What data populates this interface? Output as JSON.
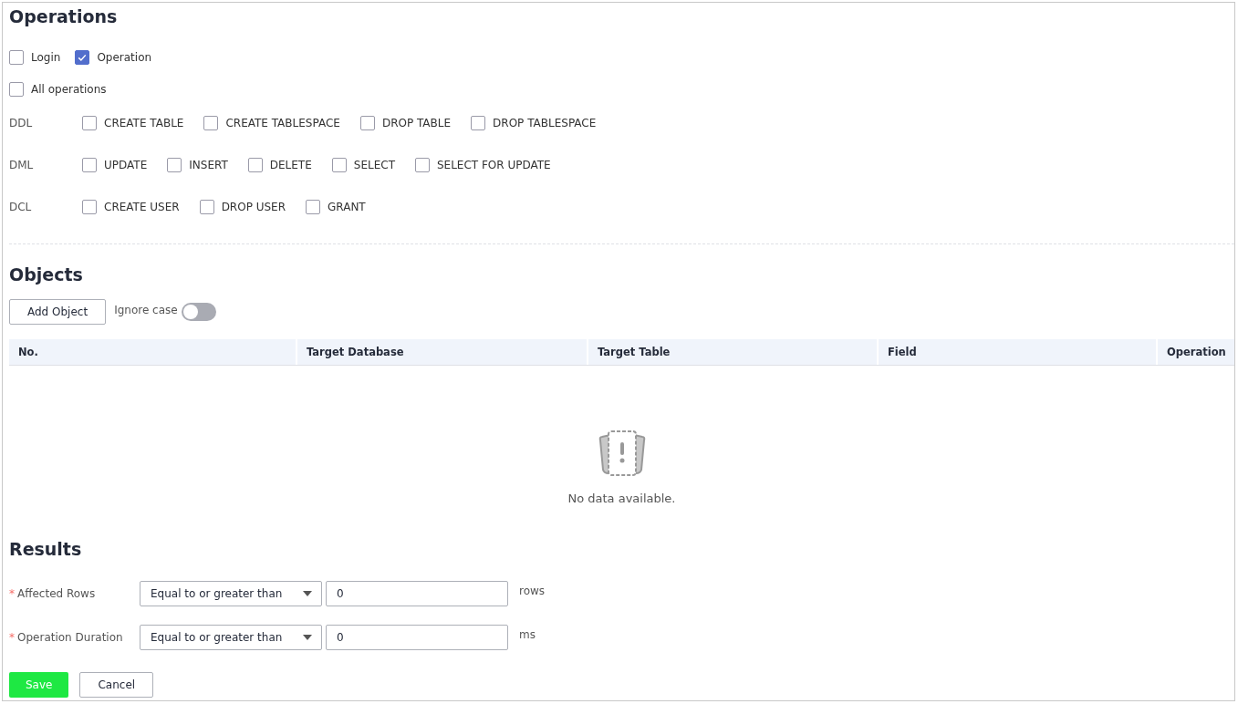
{
  "operations": {
    "title": "Operations",
    "types": [
      {
        "label": "Login",
        "checked": false
      },
      {
        "label": "Operation",
        "checked": true
      }
    ],
    "all": {
      "label": "All operations",
      "checked": false
    },
    "groups": [
      {
        "name": "DDL",
        "items": [
          {
            "label": "CREATE TABLE",
            "checked": false
          },
          {
            "label": "CREATE TABLESPACE",
            "checked": false
          },
          {
            "label": "DROP TABLE",
            "checked": false
          },
          {
            "label": "DROP TABLESPACE",
            "checked": false
          }
        ]
      },
      {
        "name": "DML",
        "items": [
          {
            "label": "UPDATE",
            "checked": false
          },
          {
            "label": "INSERT",
            "checked": false
          },
          {
            "label": "DELETE",
            "checked": false
          },
          {
            "label": "SELECT",
            "checked": false
          },
          {
            "label": "SELECT FOR UPDATE",
            "checked": false
          }
        ]
      },
      {
        "name": "DCL",
        "items": [
          {
            "label": "CREATE USER",
            "checked": false
          },
          {
            "label": "DROP USER",
            "checked": false
          },
          {
            "label": "GRANT",
            "checked": false
          }
        ]
      }
    ]
  },
  "objects": {
    "title": "Objects",
    "add_button": "Add Object",
    "ignore_case": {
      "label": "Ignore case",
      "on": false
    },
    "table": {
      "columns": [
        "No.",
        "Target Database",
        "Target Table",
        "Field",
        "Operation"
      ],
      "empty_text": "No data available."
    }
  },
  "results": {
    "title": "Results",
    "rows": [
      {
        "marker": "*",
        "label": "Affected Rows",
        "condition": "Equal to or greater than",
        "value": "0",
        "unit": "rows"
      },
      {
        "marker": "*",
        "label": "Operation Duration",
        "condition": "Equal to or greater than",
        "value": "0",
        "unit": "ms"
      }
    ]
  },
  "buttons": {
    "save": "Save",
    "cancel": "Cancel"
  }
}
